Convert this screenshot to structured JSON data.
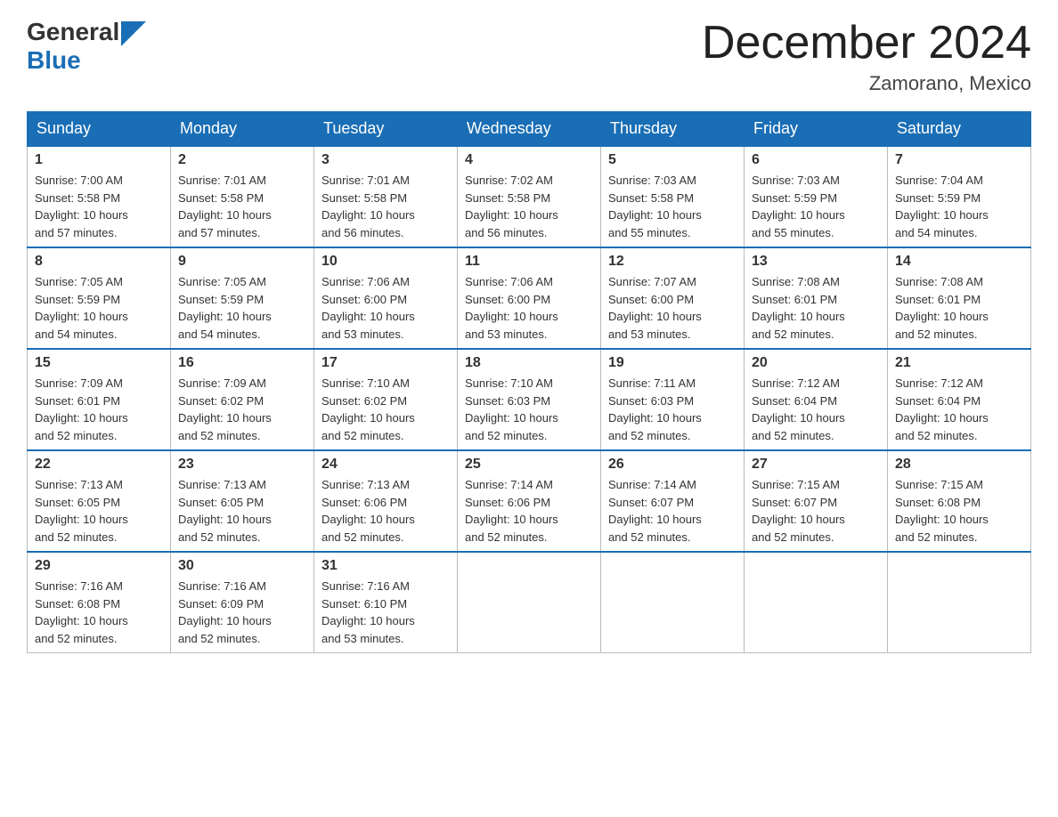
{
  "header": {
    "logo_general": "General",
    "logo_blue": "Blue",
    "month_title": "December 2024",
    "location": "Zamorano, Mexico"
  },
  "weekdays": [
    "Sunday",
    "Monday",
    "Tuesday",
    "Wednesday",
    "Thursday",
    "Friday",
    "Saturday"
  ],
  "weeks": [
    [
      {
        "day": "1",
        "sunrise": "7:00 AM",
        "sunset": "5:58 PM",
        "daylight": "10 hours and 57 minutes."
      },
      {
        "day": "2",
        "sunrise": "7:01 AM",
        "sunset": "5:58 PM",
        "daylight": "10 hours and 57 minutes."
      },
      {
        "day": "3",
        "sunrise": "7:01 AM",
        "sunset": "5:58 PM",
        "daylight": "10 hours and 56 minutes."
      },
      {
        "day": "4",
        "sunrise": "7:02 AM",
        "sunset": "5:58 PM",
        "daylight": "10 hours and 56 minutes."
      },
      {
        "day": "5",
        "sunrise": "7:03 AM",
        "sunset": "5:58 PM",
        "daylight": "10 hours and 55 minutes."
      },
      {
        "day": "6",
        "sunrise": "7:03 AM",
        "sunset": "5:59 PM",
        "daylight": "10 hours and 55 minutes."
      },
      {
        "day": "7",
        "sunrise": "7:04 AM",
        "sunset": "5:59 PM",
        "daylight": "10 hours and 54 minutes."
      }
    ],
    [
      {
        "day": "8",
        "sunrise": "7:05 AM",
        "sunset": "5:59 PM",
        "daylight": "10 hours and 54 minutes."
      },
      {
        "day": "9",
        "sunrise": "7:05 AM",
        "sunset": "5:59 PM",
        "daylight": "10 hours and 54 minutes."
      },
      {
        "day": "10",
        "sunrise": "7:06 AM",
        "sunset": "6:00 PM",
        "daylight": "10 hours and 53 minutes."
      },
      {
        "day": "11",
        "sunrise": "7:06 AM",
        "sunset": "6:00 PM",
        "daylight": "10 hours and 53 minutes."
      },
      {
        "day": "12",
        "sunrise": "7:07 AM",
        "sunset": "6:00 PM",
        "daylight": "10 hours and 53 minutes."
      },
      {
        "day": "13",
        "sunrise": "7:08 AM",
        "sunset": "6:01 PM",
        "daylight": "10 hours and 52 minutes."
      },
      {
        "day": "14",
        "sunrise": "7:08 AM",
        "sunset": "6:01 PM",
        "daylight": "10 hours and 52 minutes."
      }
    ],
    [
      {
        "day": "15",
        "sunrise": "7:09 AM",
        "sunset": "6:01 PM",
        "daylight": "10 hours and 52 minutes."
      },
      {
        "day": "16",
        "sunrise": "7:09 AM",
        "sunset": "6:02 PM",
        "daylight": "10 hours and 52 minutes."
      },
      {
        "day": "17",
        "sunrise": "7:10 AM",
        "sunset": "6:02 PM",
        "daylight": "10 hours and 52 minutes."
      },
      {
        "day": "18",
        "sunrise": "7:10 AM",
        "sunset": "6:03 PM",
        "daylight": "10 hours and 52 minutes."
      },
      {
        "day": "19",
        "sunrise": "7:11 AM",
        "sunset": "6:03 PM",
        "daylight": "10 hours and 52 minutes."
      },
      {
        "day": "20",
        "sunrise": "7:12 AM",
        "sunset": "6:04 PM",
        "daylight": "10 hours and 52 minutes."
      },
      {
        "day": "21",
        "sunrise": "7:12 AM",
        "sunset": "6:04 PM",
        "daylight": "10 hours and 52 minutes."
      }
    ],
    [
      {
        "day": "22",
        "sunrise": "7:13 AM",
        "sunset": "6:05 PM",
        "daylight": "10 hours and 52 minutes."
      },
      {
        "day": "23",
        "sunrise": "7:13 AM",
        "sunset": "6:05 PM",
        "daylight": "10 hours and 52 minutes."
      },
      {
        "day": "24",
        "sunrise": "7:13 AM",
        "sunset": "6:06 PM",
        "daylight": "10 hours and 52 minutes."
      },
      {
        "day": "25",
        "sunrise": "7:14 AM",
        "sunset": "6:06 PM",
        "daylight": "10 hours and 52 minutes."
      },
      {
        "day": "26",
        "sunrise": "7:14 AM",
        "sunset": "6:07 PM",
        "daylight": "10 hours and 52 minutes."
      },
      {
        "day": "27",
        "sunrise": "7:15 AM",
        "sunset": "6:07 PM",
        "daylight": "10 hours and 52 minutes."
      },
      {
        "day": "28",
        "sunrise": "7:15 AM",
        "sunset": "6:08 PM",
        "daylight": "10 hours and 52 minutes."
      }
    ],
    [
      {
        "day": "29",
        "sunrise": "7:16 AM",
        "sunset": "6:08 PM",
        "daylight": "10 hours and 52 minutes."
      },
      {
        "day": "30",
        "sunrise": "7:16 AM",
        "sunset": "6:09 PM",
        "daylight": "10 hours and 52 minutes."
      },
      {
        "day": "31",
        "sunrise": "7:16 AM",
        "sunset": "6:10 PM",
        "daylight": "10 hours and 53 minutes."
      },
      null,
      null,
      null,
      null
    ]
  ],
  "labels": {
    "sunrise": "Sunrise:",
    "sunset": "Sunset:",
    "daylight": "Daylight:"
  }
}
